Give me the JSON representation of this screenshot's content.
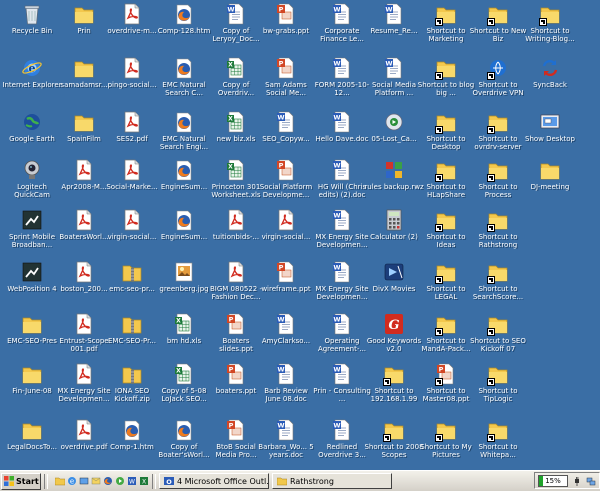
{
  "desktop": {
    "icons": [
      {
        "label": "Recycle Bin",
        "type": "bin"
      },
      {
        "label": "Internet Explorer",
        "type": "ie"
      },
      {
        "label": "Google Earth",
        "type": "earth"
      },
      {
        "label": "Logitech QuickCam",
        "type": "cam"
      },
      {
        "label": "Sprint Mobile Broadban...",
        "type": "app"
      },
      {
        "label": "WebPosition 4",
        "type": "app"
      },
      {
        "label": "EMC-SEO-Pres",
        "type": "folder"
      },
      {
        "label": "Fin-June-08",
        "type": "folder"
      },
      {
        "label": "LegalDocsTo...",
        "type": "folder"
      },
      {
        "label": "Prin",
        "type": "folder"
      },
      {
        "label": "samadamsr...",
        "type": "folder"
      },
      {
        "label": "SpainFilm",
        "type": "folder"
      },
      {
        "label": "Apr2008-M...",
        "type": "pdf"
      },
      {
        "label": "BoatersWorl...",
        "type": "pdf"
      },
      {
        "label": "boston_200...",
        "type": "pdf"
      },
      {
        "label": "Entrust-Scope 001.pdf",
        "type": "pdf"
      },
      {
        "label": "MX Energy Site Developmen...",
        "type": "pdf"
      },
      {
        "label": "overdrive.pdf",
        "type": "pdf"
      },
      {
        "label": "overdrive-m...",
        "type": "pdf"
      },
      {
        "label": "pingo-social...",
        "type": "pdf"
      },
      {
        "label": "SES2.pdf",
        "type": "pdf"
      },
      {
        "label": "Social-Marke...",
        "type": "pdf"
      },
      {
        "label": "virgin-social...",
        "type": "pdf"
      },
      {
        "label": "emc-seo-pr...",
        "type": "zip"
      },
      {
        "label": "EMC-SEO-Pr...",
        "type": "zip"
      },
      {
        "label": "IONA SEO Kickoff.zip",
        "type": "zip"
      },
      {
        "label": "Comp-1.htm",
        "type": "firefox"
      },
      {
        "label": "Comp-128.htm",
        "type": "firefox"
      },
      {
        "label": "EMC Natural Search C...",
        "type": "firefox"
      },
      {
        "label": "EMC Natural Search Engi...",
        "type": "firefox"
      },
      {
        "label": "EngineSum...",
        "type": "firefox"
      },
      {
        "label": "EngineSum...",
        "type": "firefox"
      },
      {
        "label": "greenberg.jpg",
        "type": "image"
      },
      {
        "label": "bm hd.xls",
        "type": "excel"
      },
      {
        "label": "Copy of 5-08 LoJack SEO...",
        "type": "excel"
      },
      {
        "label": "Copy of Boater'sWorl...",
        "type": "firefox"
      },
      {
        "label": "Copy of Leryoy_Doc...",
        "type": "word"
      },
      {
        "label": "Copy of Overdriv...",
        "type": "excel"
      },
      {
        "label": "new biz.xls",
        "type": "excel"
      },
      {
        "label": "Princeton 301 Worksheet.xls",
        "type": "excel"
      },
      {
        "label": "tuitionbids-...",
        "type": "pdf"
      },
      {
        "label": "BIGM 080522 - Fashion Dec...",
        "type": "pdf"
      },
      {
        "label": "Boaters slides.ppt",
        "type": "ppt"
      },
      {
        "label": "boaters.ppt",
        "type": "ppt"
      },
      {
        "label": "BtoB Social Media Pro...",
        "type": "ppt"
      },
      {
        "label": "bw-grabs.ppt",
        "type": "ppt"
      },
      {
        "label": "Sam Adams Social Me...",
        "type": "ppt"
      },
      {
        "label": "SEO_Copyw...",
        "type": "word"
      },
      {
        "label": "Social Platform Developme...",
        "type": "ppt"
      },
      {
        "label": "virgin-social...",
        "type": "pdf"
      },
      {
        "label": "wireframe.ppt",
        "type": "ppt"
      },
      {
        "label": "AmyClarkso...",
        "type": "word"
      },
      {
        "label": "Barb Review June 08.doc",
        "type": "word"
      },
      {
        "label": "Barbara_Wo... 5 years.doc",
        "type": "word"
      },
      {
        "label": "Corporate Finance Le...",
        "type": "word"
      },
      {
        "label": "FORM 2005-10-12...",
        "type": "word"
      },
      {
        "label": "Hello Dave.doc",
        "type": "word"
      },
      {
        "label": "HG Will (Chris edits) (2).doc",
        "type": "word"
      },
      {
        "label": "MX Energy Site Developmen...",
        "type": "word"
      },
      {
        "label": "MX Energy Site Developmen...",
        "type": "word"
      },
      {
        "label": "Operating Agreement-...",
        "type": "word"
      },
      {
        "label": "Prin - Consulting ...",
        "type": "word"
      },
      {
        "label": "Redlined Overdrive 3...",
        "type": "word"
      },
      {
        "label": "Resume_Re...",
        "type": "word"
      },
      {
        "label": "Social Media Platform ...",
        "type": "word"
      },
      {
        "label": "05-Lost_Ca...",
        "type": "media"
      },
      {
        "label": "rules backup.rwz",
        "type": "rules"
      },
      {
        "label": "Calculator (2)",
        "type": "calc"
      },
      {
        "label": "DivX Movies",
        "type": "divx"
      },
      {
        "label": "Good Keywords v2.0",
        "type": "keywords"
      },
      {
        "label": "Shortcut to 192.168.1.99",
        "type": "shortcut-folder"
      },
      {
        "label": "Shortcut to 2008 Scopes",
        "type": "shortcut-folder"
      },
      {
        "label": "Shortcut to Marketing",
        "type": "shortcut-folder"
      },
      {
        "label": "Shortcut to blog big ...",
        "type": "shortcut-folder"
      },
      {
        "label": "Shortcut to Desktop",
        "type": "shortcut-folder"
      },
      {
        "label": "Shortcut to HLapShare",
        "type": "shortcut-folder"
      },
      {
        "label": "Shortcut to Ideas",
        "type": "shortcut-folder"
      },
      {
        "label": "Shortcut to LEGAL",
        "type": "shortcut-folder"
      },
      {
        "label": "Shortcut to MandA-Pack...",
        "type": "shortcut-folder"
      },
      {
        "label": "Shortcut to Master08.ppt",
        "type": "shortcut-ppt"
      },
      {
        "label": "Shortcut to My Pictures",
        "type": "shortcut-folder"
      },
      {
        "label": "Shortcut to New Biz",
        "type": "shortcut-folder"
      },
      {
        "label": "Shortcut to Overdrive VPN",
        "type": "shortcut-app"
      },
      {
        "label": "Shortcut to ovrdrv-server",
        "type": "shortcut-folder"
      },
      {
        "label": "Shortcut to Process",
        "type": "shortcut-folder"
      },
      {
        "label": "Shortcut to Rathstrong",
        "type": "shortcut-folder"
      },
      {
        "label": "Shortcut to SearchScore...",
        "type": "shortcut-folder"
      },
      {
        "label": "Shortcut to SEO Kickoff 07",
        "type": "shortcut-folder"
      },
      {
        "label": "Shortcut to TipLogic",
        "type": "shortcut-folder"
      },
      {
        "label": "Shortcut to Whitepa...",
        "type": "shortcut-folder"
      },
      {
        "label": "Shortcut to Writing-Blog...",
        "type": "shortcut-folder"
      },
      {
        "label": "SyncBack",
        "type": "sync"
      },
      {
        "label": "Show Desktop",
        "type": "showdesk"
      },
      {
        "label": "DJ-meeting",
        "type": "folder"
      }
    ]
  },
  "taskbar": {
    "start_label": "Start",
    "tasks": [
      {
        "label": "4 Microsoft Office Outl...",
        "icon": "outlook-icon"
      },
      {
        "label": "Rathstrong",
        "icon": "folder-icon"
      }
    ],
    "battery_percent": 15,
    "battery_label": "15%"
  }
}
